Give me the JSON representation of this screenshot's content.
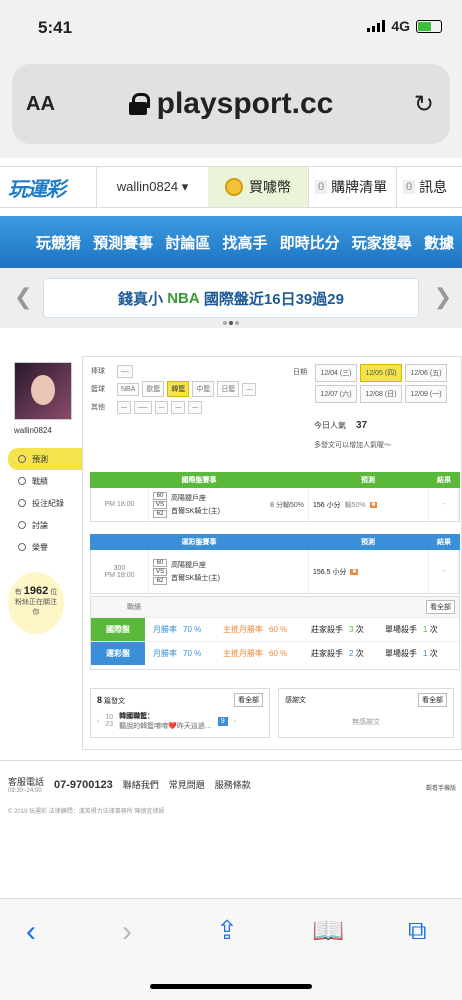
{
  "status": {
    "time": "5:41",
    "network": "4G"
  },
  "browser": {
    "aa": "AA",
    "url": "playsport.cc"
  },
  "topnav": {
    "logo": "玩運彩",
    "username": "wallin0824 ▾",
    "coin_label": "買噱幣",
    "cart_count": "0",
    "cart_label": "購牌清單",
    "msg_count": "0",
    "msg_label": "訊息"
  },
  "mainnav": [
    "玩競猜",
    "預測賽事",
    "討論區",
    "找高手",
    "即時比分",
    "玩家搜尋",
    "數據"
  ],
  "ticker": {
    "prefix": "錢真小",
    "league": "NBA",
    "text": "國際盤近16日39過29"
  },
  "profile": {
    "name": "wallin0824"
  },
  "side_menu": [
    "預測",
    "戰績",
    "投注紀錄",
    "討論",
    "榮譽"
  ],
  "bulb": {
    "prefix": "有",
    "count": "1962",
    "unit": "位",
    "text": "粉絲正在關注你"
  },
  "filters": [
    {
      "key": "棒球",
      "items": [
        {
          "t": "",
          "s": "off"
        }
      ]
    },
    {
      "key": "籃球",
      "items": [
        {
          "t": "NBA",
          "s": ""
        },
        {
          "t": "歐籃",
          "s": ""
        },
        {
          "t": "韓籃",
          "s": "sel"
        },
        {
          "t": "中籃",
          "s": ""
        },
        {
          "t": "日籃",
          "s": ""
        },
        {
          "t": "",
          "s": "off"
        }
      ]
    },
    {
      "key": "其他",
      "items": [
        {
          "t": "",
          "s": "off"
        },
        {
          "t": "",
          "s": "off"
        },
        {
          "t": "",
          "s": "off"
        },
        {
          "t": "",
          "s": "off"
        },
        {
          "t": "",
          "s": "off"
        }
      ]
    }
  ],
  "dates": {
    "label": "日期",
    "items": [
      {
        "t": "12/04 (三)",
        "s": ""
      },
      {
        "t": "12/05 (四)",
        "s": "sel"
      },
      {
        "t": "12/06 (五)",
        "s": ""
      },
      {
        "t": "12/07 (六)",
        "s": ""
      },
      {
        "t": "12/08 (日)",
        "s": ""
      },
      {
        "t": "12/09 (一)",
        "s": ""
      }
    ]
  },
  "popularity": {
    "label": "今日人氣",
    "value": "37",
    "hint": "多發文可以增加人氣喔～"
  },
  "intl": {
    "title": "國際盤賽事",
    "pred": "預測",
    "result": "結果",
    "time": "PM 18:00",
    "s1": "60",
    "s2": "62",
    "vs": "VS",
    "team1": "高陽獵戶座",
    "team2": "首爾SK騎士(主)",
    "line": "8 分輸50%",
    "pick": "156 小分",
    "pick2": "輸50%",
    "res": "-"
  },
  "lottery": {
    "title": "運彩盤賽事",
    "pred": "預測",
    "result": "結果",
    "no": "300",
    "time": "PM 18:00",
    "s1": "60",
    "s2": "62",
    "vs": "VS",
    "team1": "高陽獵戶座",
    "team2": "首爾SK騎士(主)",
    "pick": "156.5 小分",
    "res": "-"
  },
  "record": {
    "title": "戰績",
    "all": "看全部",
    "rows": [
      {
        "label": "國際盤",
        "color": "#5ab93a",
        "m1": "月勝率",
        "v1": "70",
        "m2": "主推月勝率",
        "v2": "60",
        "m3": "莊家殺手",
        "v3": "3",
        "m4": "單場殺手",
        "v4": "1",
        "unit": "%",
        "unit2": "次"
      },
      {
        "label": "運彩盤",
        "color": "#3a8fd8",
        "m1": "月勝率",
        "v1": "70",
        "m2": "主推月勝率",
        "v2": "60",
        "m3": "莊家殺手",
        "v3": "2",
        "m4": "單場殺手",
        "v4": "1",
        "unit": "%",
        "unit2": "次"
      }
    ]
  },
  "posts": {
    "count": "8",
    "label": "篇發文",
    "all": "看全部",
    "day": "10",
    "date": "23",
    "title": "韓國職籃：",
    "text": "聽說的韓籃唷唷❤️昨天這過…",
    "badge": "9"
  },
  "thanks": {
    "label": "感謝文",
    "all": "看全部",
    "empty": "無感謝文"
  },
  "footer": {
    "svc": "客服電話",
    "hours": "09:30~24:00",
    "phone": "07-9700123",
    "contact": "聯絡我們",
    "faq": "常見問題",
    "terms": "服務條款",
    "copy": "© 2019 玩運彩 法律顧問：漢英得力法律事務所 陳德宜律師",
    "mobile": "觀看手機版"
  }
}
